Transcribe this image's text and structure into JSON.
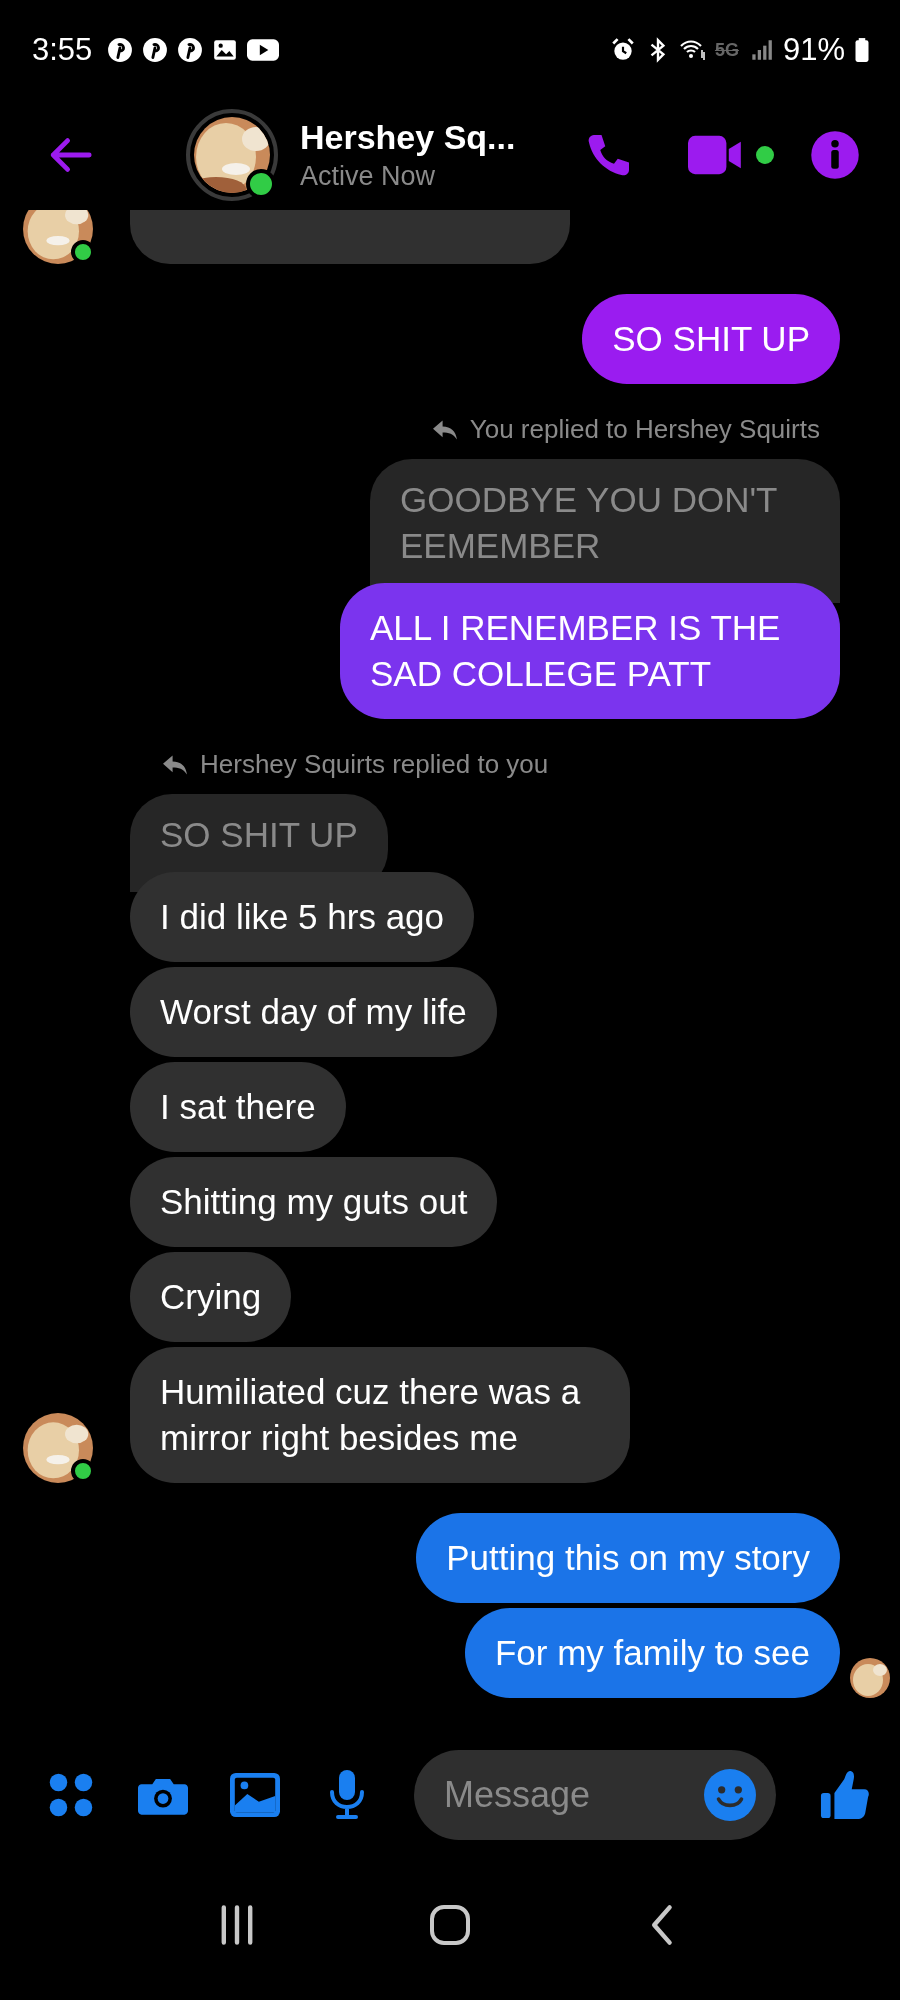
{
  "status_bar": {
    "time": "3:55",
    "network": "5G",
    "battery": "91%"
  },
  "header": {
    "title": "Hershey Sq...",
    "subtitle": "Active Now",
    "online": true,
    "video_active": true
  },
  "messages": [
    {
      "kind": "incoming",
      "clipped": true,
      "avatar": {
        "online": true
      }
    },
    {
      "kind": "outgoing",
      "text": "SO SHIT UP",
      "color": "#9a1cf0"
    },
    {
      "kind": "outgoing",
      "reply": {
        "label": "You replied to Hershey Squirts",
        "quoted": "GOODBYE YOU DON'T EEMEMBER"
      },
      "text": "ALL I RENEMBER IS THE SAD COLLEGE PATT",
      "color": "#7b34ee"
    },
    {
      "kind": "incoming",
      "reply": {
        "label": "Hershey Squirts replied to you",
        "quoted": "SO SHIT UP"
      },
      "text": "I did like 5 hrs ago"
    },
    {
      "kind": "incoming",
      "text": "Worst day of my life"
    },
    {
      "kind": "incoming",
      "text": "I sat there"
    },
    {
      "kind": "incoming",
      "text": "Shitting my guts out"
    },
    {
      "kind": "incoming",
      "text": "Crying"
    },
    {
      "kind": "incoming",
      "text": "Humiliated cuz there was a mirror right besides me",
      "avatar": {
        "online": true
      }
    },
    {
      "kind": "outgoing",
      "text": "Putting this on my story",
      "color": "#1b74e8"
    },
    {
      "kind": "outgoing",
      "text": "For my family to see",
      "color": "#1b74e8",
      "seen": true
    }
  ],
  "composer": {
    "placeholder": "Message"
  }
}
